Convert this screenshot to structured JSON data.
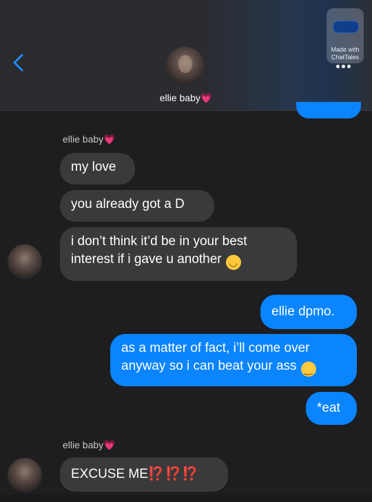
{
  "header": {
    "contact_name": "ellie baby",
    "heart": "💗",
    "watermark": "Made with ChatTales",
    "back_icon": "chevron-left-icon",
    "more_icon": "ellipsis-icon"
  },
  "messages": [
    {
      "from": "ellie",
      "sender": "ellie baby",
      "text": "my love"
    },
    {
      "from": "ellie",
      "text": "you already got a D"
    },
    {
      "from": "ellie",
      "line1": "i don’t think it’d be in your best",
      "line2": "interest if i gave u another",
      "emoji": "🙃"
    },
    {
      "from": "me",
      "text": "ellie dpmo."
    },
    {
      "from": "me",
      "line1": "as a matter of fact, i’ll come over",
      "line2": "anyway so i can beat your ass",
      "emoji": "🤗"
    },
    {
      "from": "me",
      "text": "*eat"
    },
    {
      "from": "ellie",
      "sender": "ellie baby",
      "text": "EXCUSE ME",
      "marks": "⁉️⁉️⁉️"
    }
  ],
  "colors": {
    "incoming_bubble": "#3a3a3c",
    "outgoing_bubble": "#0a84ff",
    "background": "#1e1e20"
  }
}
